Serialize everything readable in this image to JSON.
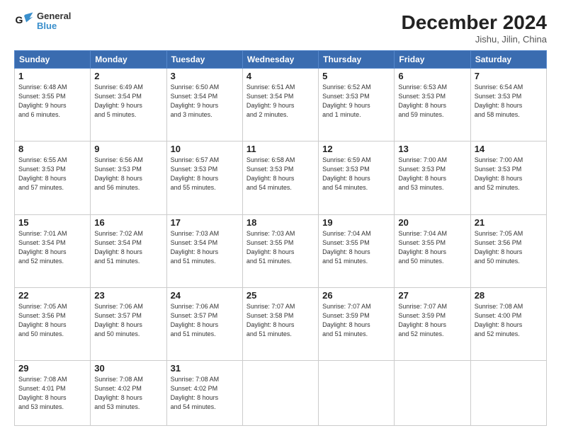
{
  "header": {
    "logo_line1": "General",
    "logo_line2": "Blue",
    "month": "December 2024",
    "location": "Jishu, Jilin, China"
  },
  "weekdays": [
    "Sunday",
    "Monday",
    "Tuesday",
    "Wednesday",
    "Thursday",
    "Friday",
    "Saturday"
  ],
  "weeks": [
    [
      {
        "day": "1",
        "info": "Sunrise: 6:48 AM\nSunset: 3:55 PM\nDaylight: 9 hours\nand 6 minutes."
      },
      {
        "day": "2",
        "info": "Sunrise: 6:49 AM\nSunset: 3:54 PM\nDaylight: 9 hours\nand 5 minutes."
      },
      {
        "day": "3",
        "info": "Sunrise: 6:50 AM\nSunset: 3:54 PM\nDaylight: 9 hours\nand 3 minutes."
      },
      {
        "day": "4",
        "info": "Sunrise: 6:51 AM\nSunset: 3:54 PM\nDaylight: 9 hours\nand 2 minutes."
      },
      {
        "day": "5",
        "info": "Sunrise: 6:52 AM\nSunset: 3:53 PM\nDaylight: 9 hours\nand 1 minute."
      },
      {
        "day": "6",
        "info": "Sunrise: 6:53 AM\nSunset: 3:53 PM\nDaylight: 8 hours\nand 59 minutes."
      },
      {
        "day": "7",
        "info": "Sunrise: 6:54 AM\nSunset: 3:53 PM\nDaylight: 8 hours\nand 58 minutes."
      }
    ],
    [
      {
        "day": "8",
        "info": "Sunrise: 6:55 AM\nSunset: 3:53 PM\nDaylight: 8 hours\nand 57 minutes."
      },
      {
        "day": "9",
        "info": "Sunrise: 6:56 AM\nSunset: 3:53 PM\nDaylight: 8 hours\nand 56 minutes."
      },
      {
        "day": "10",
        "info": "Sunrise: 6:57 AM\nSunset: 3:53 PM\nDaylight: 8 hours\nand 55 minutes."
      },
      {
        "day": "11",
        "info": "Sunrise: 6:58 AM\nSunset: 3:53 PM\nDaylight: 8 hours\nand 54 minutes."
      },
      {
        "day": "12",
        "info": "Sunrise: 6:59 AM\nSunset: 3:53 PM\nDaylight: 8 hours\nand 54 minutes."
      },
      {
        "day": "13",
        "info": "Sunrise: 7:00 AM\nSunset: 3:53 PM\nDaylight: 8 hours\nand 53 minutes."
      },
      {
        "day": "14",
        "info": "Sunrise: 7:00 AM\nSunset: 3:53 PM\nDaylight: 8 hours\nand 52 minutes."
      }
    ],
    [
      {
        "day": "15",
        "info": "Sunrise: 7:01 AM\nSunset: 3:54 PM\nDaylight: 8 hours\nand 52 minutes."
      },
      {
        "day": "16",
        "info": "Sunrise: 7:02 AM\nSunset: 3:54 PM\nDaylight: 8 hours\nand 51 minutes."
      },
      {
        "day": "17",
        "info": "Sunrise: 7:03 AM\nSunset: 3:54 PM\nDaylight: 8 hours\nand 51 minutes."
      },
      {
        "day": "18",
        "info": "Sunrise: 7:03 AM\nSunset: 3:55 PM\nDaylight: 8 hours\nand 51 minutes."
      },
      {
        "day": "19",
        "info": "Sunrise: 7:04 AM\nSunset: 3:55 PM\nDaylight: 8 hours\nand 51 minutes."
      },
      {
        "day": "20",
        "info": "Sunrise: 7:04 AM\nSunset: 3:55 PM\nDaylight: 8 hours\nand 50 minutes."
      },
      {
        "day": "21",
        "info": "Sunrise: 7:05 AM\nSunset: 3:56 PM\nDaylight: 8 hours\nand 50 minutes."
      }
    ],
    [
      {
        "day": "22",
        "info": "Sunrise: 7:05 AM\nSunset: 3:56 PM\nDaylight: 8 hours\nand 50 minutes."
      },
      {
        "day": "23",
        "info": "Sunrise: 7:06 AM\nSunset: 3:57 PM\nDaylight: 8 hours\nand 50 minutes."
      },
      {
        "day": "24",
        "info": "Sunrise: 7:06 AM\nSunset: 3:57 PM\nDaylight: 8 hours\nand 51 minutes."
      },
      {
        "day": "25",
        "info": "Sunrise: 7:07 AM\nSunset: 3:58 PM\nDaylight: 8 hours\nand 51 minutes."
      },
      {
        "day": "26",
        "info": "Sunrise: 7:07 AM\nSunset: 3:59 PM\nDaylight: 8 hours\nand 51 minutes."
      },
      {
        "day": "27",
        "info": "Sunrise: 7:07 AM\nSunset: 3:59 PM\nDaylight: 8 hours\nand 52 minutes."
      },
      {
        "day": "28",
        "info": "Sunrise: 7:08 AM\nSunset: 4:00 PM\nDaylight: 8 hours\nand 52 minutes."
      }
    ],
    [
      {
        "day": "29",
        "info": "Sunrise: 7:08 AM\nSunset: 4:01 PM\nDaylight: 8 hours\nand 53 minutes."
      },
      {
        "day": "30",
        "info": "Sunrise: 7:08 AM\nSunset: 4:02 PM\nDaylight: 8 hours\nand 53 minutes."
      },
      {
        "day": "31",
        "info": "Sunrise: 7:08 AM\nSunset: 4:02 PM\nDaylight: 8 hours\nand 54 minutes."
      },
      {
        "day": "",
        "info": "",
        "empty": true
      },
      {
        "day": "",
        "info": "",
        "empty": true
      },
      {
        "day": "",
        "info": "",
        "empty": true
      },
      {
        "day": "",
        "info": "",
        "empty": true
      }
    ]
  ]
}
